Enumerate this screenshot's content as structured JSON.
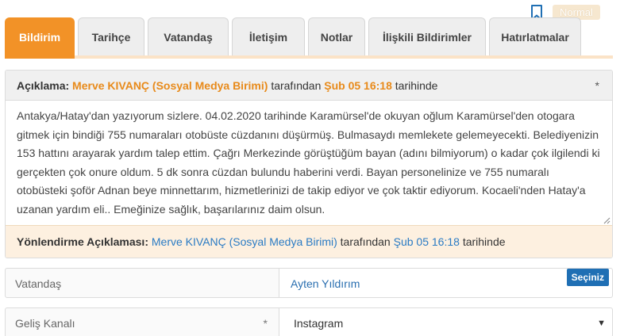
{
  "status": {
    "badge": "Normal"
  },
  "tabs": [
    {
      "label": "Bildirim",
      "active": true
    },
    {
      "label": "Tarihçe"
    },
    {
      "label": "Vatandaş"
    },
    {
      "label": "İletişim"
    },
    {
      "label": "Notlar"
    },
    {
      "label": "İlişkili Bildirimler"
    },
    {
      "label": "Hatırlatmalar"
    }
  ],
  "description": {
    "label": "Açıklama:",
    "author": "Merve KIVANÇ (Sosyal Medya Birimi)",
    "by": "tarafından",
    "date": "Şub 05 16:18",
    "suffix": "tarihinde",
    "required_mark": "*",
    "text": "Antakya/Hatay'dan yazıyorum sizlere. 04.02.2020 tarihinde Karamürsel'de okuyan oğlum Karamürsel'den otogara gitmek için bindiği 755 numaraları otobüste cüzdanını düşürmüş. Bulmasaydı memlekete gelemeyecekti. Belediyenizin 153 hattını arayarak yardım talep ettim. Çağrı Merkezinde görüştüğüm bayan (adını bilmiyorum) o kadar çok ilgilendi ki gerçekten çok onure oldum. 5 dk sonra cüzdan bulundu haberini verdi. Bayan personelinize ve 755 numaralı otobüsteki şoför Adnan beye minnettarım, hizmetlerinizi de takip ediyor ve çok taktir ediyorum. Kocaeli'nden Hatay'a uzanan yardım eli.. Emeğinize sağlık, başarılarınız daim olsun."
  },
  "redirect": {
    "label": "Yönlendirme Açıklaması:",
    "author": "Merve KIVANÇ (Sosyal Medya Birimi)",
    "by": "tarafından",
    "date": "Şub 05 16:18",
    "suffix": "tarihinde"
  },
  "citizen": {
    "label": "Vatandaş",
    "value": "Ayten Yıldırım",
    "button": "Seçiniz"
  },
  "channel": {
    "label": "Geliş Kanalı",
    "required_mark": "*",
    "value": "Instagram"
  },
  "colors": {
    "accent": "#f29227",
    "link": "#2a7bc4",
    "button": "#1f6fb4"
  }
}
